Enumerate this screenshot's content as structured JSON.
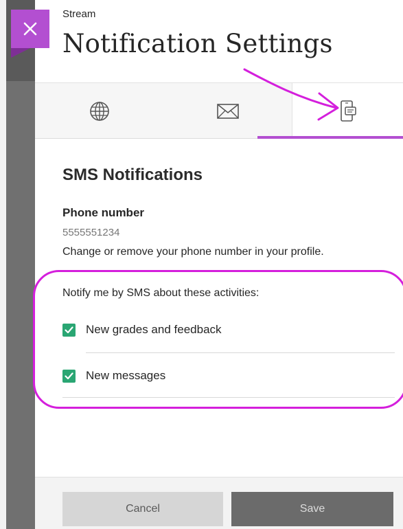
{
  "header": {
    "breadcrumb": "Stream",
    "title": "Notification Settings"
  },
  "tabs": [
    {
      "id": "web",
      "icon": "globe-icon"
    },
    {
      "id": "email",
      "icon": "envelope-icon"
    },
    {
      "id": "sms",
      "icon": "mobile-phone-icon",
      "active": true
    }
  ],
  "sms": {
    "section_title": "SMS Notifications",
    "phone_label": "Phone number",
    "phone_value": "5555551234",
    "help_text": "Change or remove your phone number in your profile.",
    "notify_label": "Notify me by SMS about these activities:",
    "options": [
      {
        "label": "New grades and feedback",
        "checked": true
      },
      {
        "label": "New messages",
        "checked": true
      }
    ]
  },
  "footer": {
    "cancel_label": "Cancel",
    "save_label": "Save"
  },
  "colors": {
    "accent": "#b34fd1",
    "annotation": "#d41fdc",
    "checkbox": "#2aa673",
    "dark_strip": "#707070"
  }
}
